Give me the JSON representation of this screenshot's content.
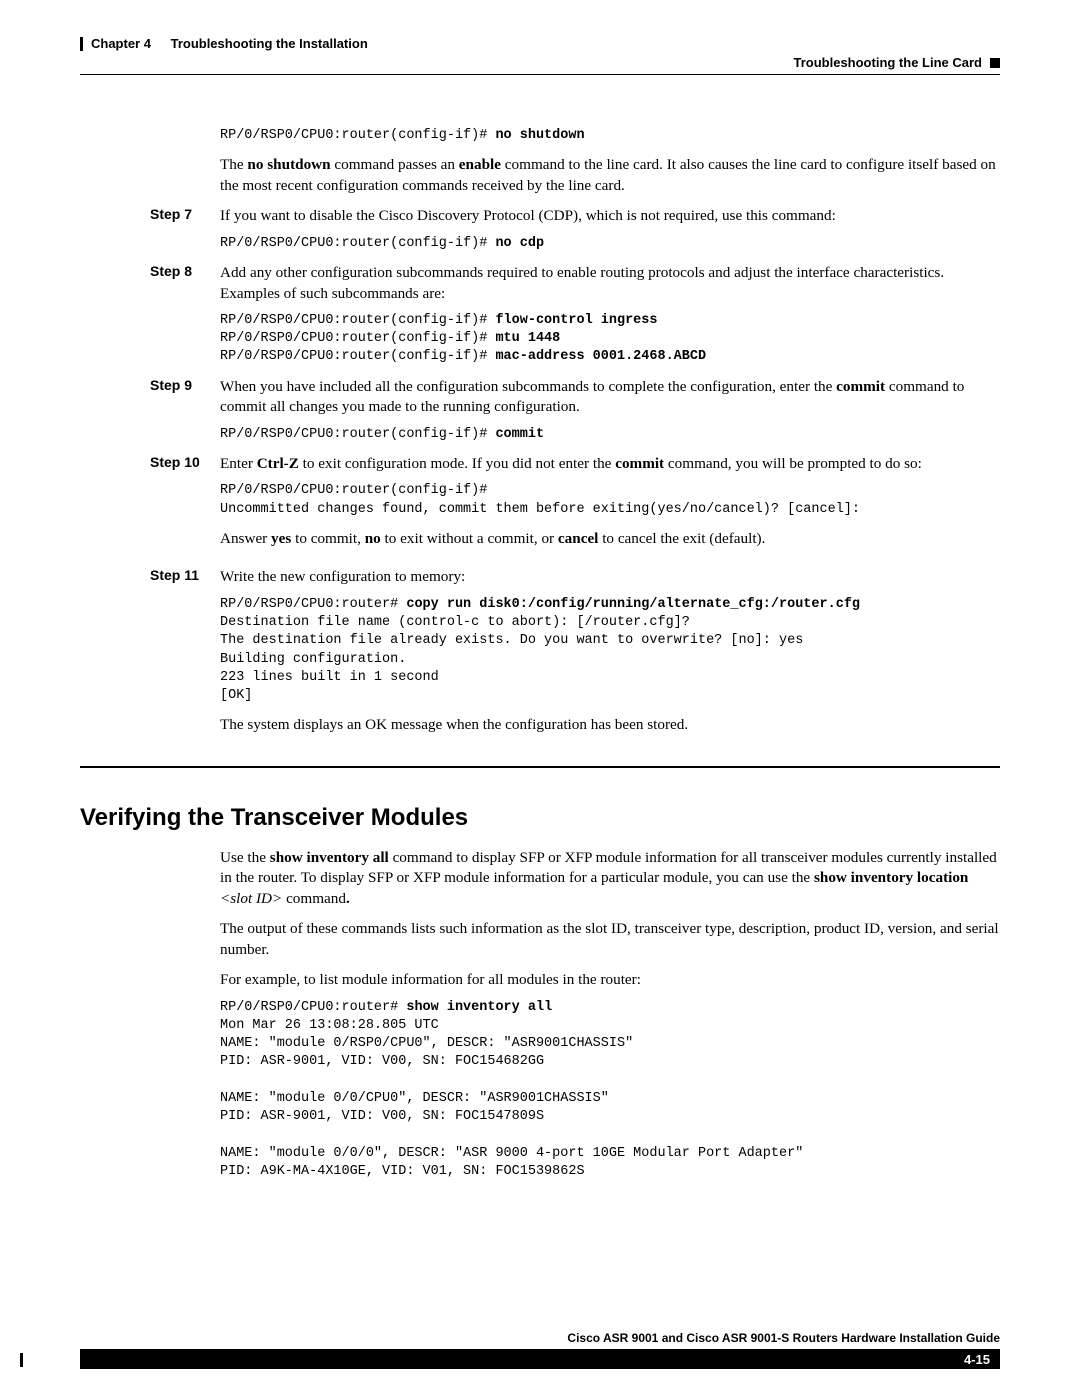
{
  "header": {
    "chapter": "Chapter 4",
    "title": "Troubleshooting the Installation",
    "breadcrumb": "Troubleshooting the Line Card"
  },
  "blocks": {
    "pre1_prompt": "RP/0/RSP0/CPU0:router(config-if)# ",
    "pre1_cmd": "no shutdown",
    "para_noshut_a": "The ",
    "para_noshut_b": "no shutdown",
    "para_noshut_c": " command passes an ",
    "para_noshut_d": "enable",
    "para_noshut_e": " command to the line card. It also causes the line card to configure itself based on the most recent configuration commands received by the line card."
  },
  "step7": {
    "label": "Step 7",
    "text": "If you want to disable the Cisco Discovery Protocol (CDP), which is not required, use this command:",
    "prompt": "RP/0/RSP0/CPU0:router(config-if)# ",
    "cmd": "no cdp"
  },
  "step8": {
    "label": "Step 8",
    "text": "Add any other configuration subcommands required to enable routing protocols and adjust the interface characteristics. Examples of such subcommands are:",
    "p1": "RP/0/RSP0/CPU0:router(config-if)# ",
    "c1": "flow-control ingress",
    "p2": "RP/0/RSP0/CPU0:router(config-if)# ",
    "c2": "mtu 1448",
    "p3": "RP/0/RSP0/CPU0:router(config-if)# ",
    "c3": "mac-address 0001.2468.ABCD"
  },
  "step9": {
    "label": "Step 9",
    "t1": "When you have included all the configuration subcommands to complete the configuration, enter the ",
    "b1": "commit",
    "t2": " command to commit all changes you made to the running configuration.",
    "prompt": "RP/0/RSP0/CPU0:router(config-if)# ",
    "cmd": "commit"
  },
  "step10": {
    "label": "Step 10",
    "t1": "Enter ",
    "b1": "Ctrl-Z",
    "t2": " to exit configuration mode. If you did not enter the ",
    "b2": "commit",
    "t3": " command, you will be prompted to do so:",
    "code": "RP/0/RSP0/CPU0:router(config-if)#\nUncommitted changes found, commit them before exiting(yes/no/cancel)? [cancel]:",
    "a1": "Answer ",
    "ab1": "yes",
    "a2": " to commit, ",
    "ab2": "no",
    "a3": " to exit without a commit, or ",
    "ab3": "cancel",
    "a4": " to cancel the exit (default)."
  },
  "step11": {
    "label": "Step 11",
    "text": "Write the new configuration to memory:",
    "prompt": "RP/0/RSP0/CPU0:router# ",
    "cmd": "copy run disk0:/config/running/alternate_cfg:/router.cfg",
    "out": "Destination file name (control-c to abort): [/router.cfg]?\nThe destination file already exists. Do you want to overwrite? [no]: yes\nBuilding configuration.\n223 lines built in 1 second\n[OK]",
    "after": "The system displays an OK message when the configuration has been stored."
  },
  "section": {
    "title": "Verifying the Transceiver Modules",
    "p1a": "Use the ",
    "p1b": "show inventory all",
    "p1c": " command to display SFP or XFP module information for all transceiver modules currently installed in the router. To display SFP or XFP module information for a particular module, you can use the ",
    "p1d": "show inventory location ",
    "p1e": "<slot ID>",
    "p1f": " command",
    "p1g": ".",
    "p2": "The output of these commands lists such information as the slot ID, transceiver type, description, product ID, version, and serial number.",
    "p3": "For example, to list module information for all modules in the router:",
    "prompt": "RP/0/RSP0/CPU0:router# ",
    "cmd": "show inventory all",
    "out": "Mon Mar 26 13:08:28.805 UTC\nNAME: \"module 0/RSP0/CPU0\", DESCR: \"ASR9001CHASSIS\"\nPID: ASR-9001, VID: V00, SN: FOC154682GG\n\nNAME: \"module 0/0/CPU0\", DESCR: \"ASR9001CHASSIS\"\nPID: ASR-9001, VID: V00, SN: FOC1547809S\n\nNAME: \"module 0/0/0\", DESCR: \"ASR 9000 4-port 10GE Modular Port Adapter\"\nPID: A9K-MA-4X10GE, VID: V01, SN: FOC1539862S"
  },
  "footer": {
    "title": "Cisco ASR 9001 and Cisco ASR 9001-S Routers Hardware Installation Guide",
    "page": "4-15"
  }
}
